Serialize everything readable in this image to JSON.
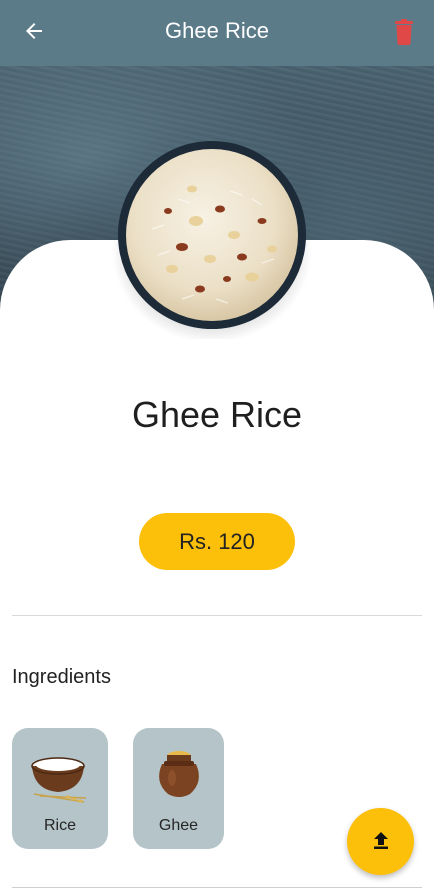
{
  "app_bar": {
    "title": "Ghee Rice",
    "back_icon": "arrow-left-icon",
    "delete_icon": "trash-icon",
    "background_color": "#5c7b89",
    "delete_color": "#e04848"
  },
  "dish": {
    "name": "Ghee Rice",
    "price": "Rs. 120",
    "image": "ghee-rice-bowl"
  },
  "ingredients": {
    "title": "Ingredients",
    "items": [
      {
        "label": "Rice",
        "icon": "rice-bowl-icon"
      },
      {
        "label": "Ghee",
        "icon": "ghee-pot-icon"
      }
    ]
  },
  "fab": {
    "icon": "upload-icon",
    "color": "#fcbf0a"
  }
}
